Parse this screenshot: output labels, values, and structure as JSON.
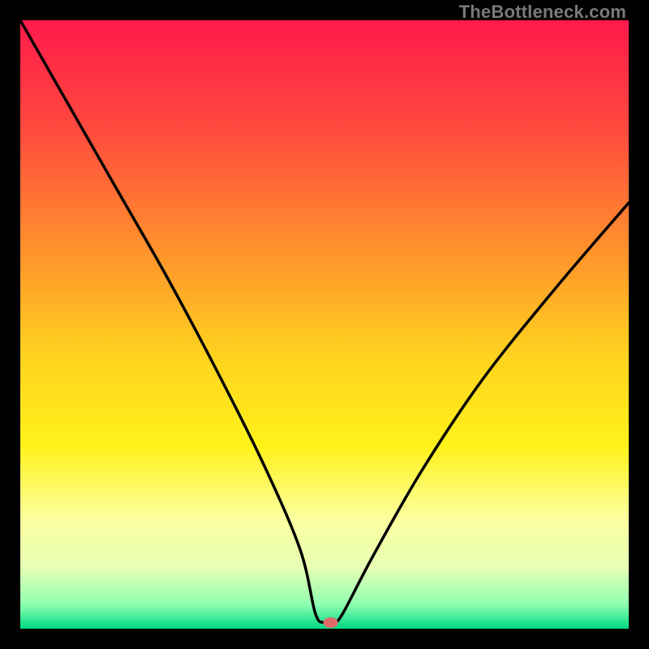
{
  "watermark": "TheBottleneck.com",
  "chart_data": {
    "type": "line",
    "title": "",
    "xlabel": "",
    "ylabel": "",
    "xlim": [
      0,
      100
    ],
    "ylim": [
      0,
      100
    ],
    "series": [
      {
        "name": "curve",
        "x": [
          0,
          8,
          16,
          24,
          32,
          40,
          46,
          48.5,
          50,
          51.5,
          53,
          58,
          66,
          76,
          88,
          100
        ],
        "values": [
          100,
          86,
          72,
          58,
          43,
          27,
          13,
          2.5,
          1,
          1,
          2.5,
          12,
          26,
          41,
          56,
          70
        ]
      }
    ],
    "marker": {
      "x": 51,
      "y": 1,
      "color": "#e06a6a"
    },
    "gradient_stops": [
      {
        "offset": 0,
        "color": "#ff1a4b"
      },
      {
        "offset": 0.18,
        "color": "#ff4a3e"
      },
      {
        "offset": 0.4,
        "color": "#ff9a2a"
      },
      {
        "offset": 0.55,
        "color": "#ffd21f"
      },
      {
        "offset": 0.7,
        "color": "#fff21a"
      },
      {
        "offset": 0.82,
        "color": "#fcffa0"
      },
      {
        "offset": 0.9,
        "color": "#e6ffb4"
      },
      {
        "offset": 0.96,
        "color": "#8fffb0"
      },
      {
        "offset": 1.0,
        "color": "#00d983"
      }
    ]
  }
}
